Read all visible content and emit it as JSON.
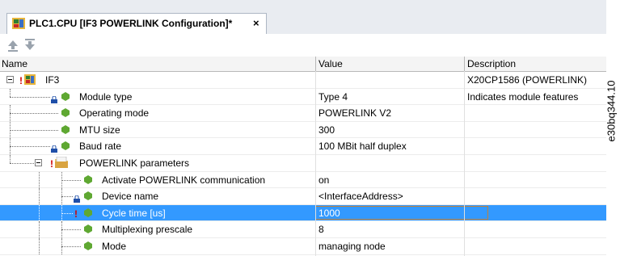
{
  "tab": {
    "title": "PLC1.CPU [IF3 POWERLINK Configuration]*",
    "close": "×"
  },
  "columns": {
    "name": "Name",
    "value": "Value",
    "description": "Description"
  },
  "rows": [
    {
      "name": "IF3",
      "value": "",
      "description": "X20CP1586 (POWERLINK)"
    },
    {
      "name": "Module type",
      "value": "Type 4",
      "description": "Indicates module features"
    },
    {
      "name": "Operating mode",
      "value": "POWERLINK V2",
      "description": ""
    },
    {
      "name": "MTU size",
      "value": "300",
      "description": ""
    },
    {
      "name": "Baud rate",
      "value": "100 MBit half duplex",
      "description": ""
    },
    {
      "name": "POWERLINK parameters",
      "value": "",
      "description": ""
    },
    {
      "name": "Activate POWERLINK communication",
      "value": "on",
      "description": ""
    },
    {
      "name": "Device name",
      "value": "<InterfaceAddress>",
      "description": ""
    },
    {
      "name": "Cycle time [us]",
      "value": "1000",
      "description": ""
    },
    {
      "name": "Multiplexing prescale",
      "value": "8",
      "description": ""
    },
    {
      "name": "Mode",
      "value": "managing node",
      "description": ""
    }
  ],
  "watermark": "e30bq344.10",
  "colors": {
    "selection": "#3399ff",
    "edit_border": "#c0803a",
    "gem": "#5fa832",
    "warning": "#d00000"
  }
}
